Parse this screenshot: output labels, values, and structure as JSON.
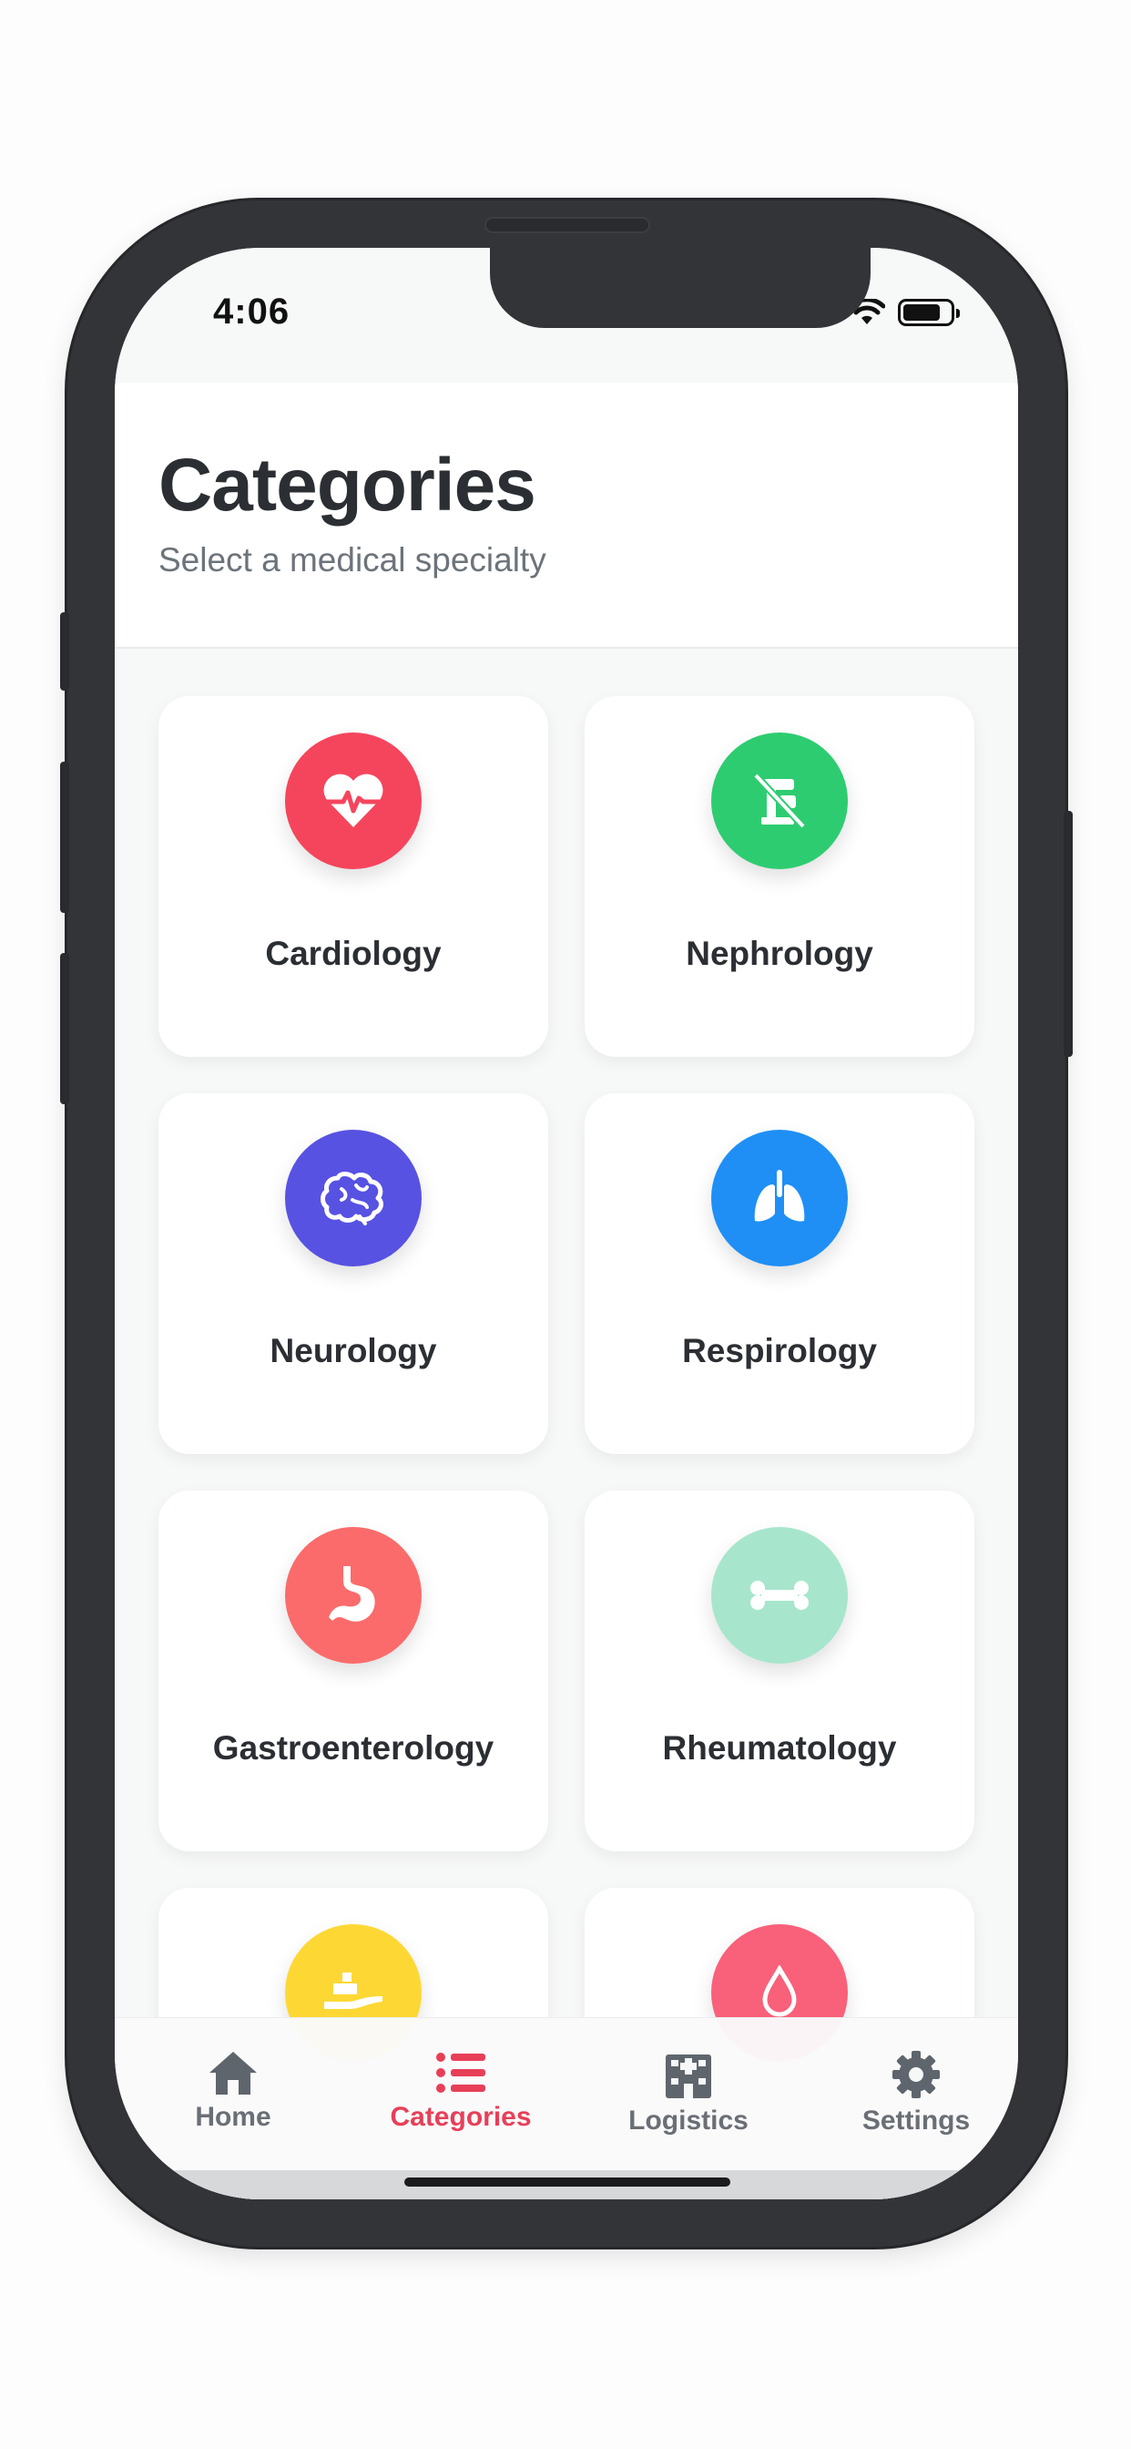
{
  "status_bar": {
    "time": "4:06"
  },
  "header": {
    "title": "Categories",
    "subtitle": "Select a medical specialty"
  },
  "categories": [
    {
      "label": "Cardiology",
      "icon": "heart-pulse-icon",
      "color": "#f5455c"
    },
    {
      "label": "Nephrology",
      "icon": "kidney-machine-icon",
      "color": "#2ecc71"
    },
    {
      "label": "Neurology",
      "icon": "brain-icon",
      "color": "#5752e2"
    },
    {
      "label": "Respirology",
      "icon": "lungs-icon",
      "color": "#1f8ff5"
    },
    {
      "label": "Gastroenterology",
      "icon": "stomach-icon",
      "color": "#fb6b6b"
    },
    {
      "label": "Rheumatology",
      "icon": "bone-icon",
      "color": "#a7e6cc"
    },
    {
      "label": "",
      "icon": "hand-pill-icon",
      "color": "#fdd835"
    },
    {
      "label": "",
      "icon": "blood-drop-icon",
      "color": "#f9607a"
    }
  ],
  "tabbar": {
    "items": [
      {
        "label": "Home",
        "icon": "home-icon",
        "active": false
      },
      {
        "label": "Categories",
        "icon": "list-icon",
        "active": true
      },
      {
        "label": "Logistics",
        "icon": "hospital-icon",
        "active": false
      },
      {
        "label": "Settings",
        "icon": "gear-icon",
        "active": false
      }
    ],
    "active_color": "#e83f58",
    "inactive_color": "#5f656c"
  }
}
